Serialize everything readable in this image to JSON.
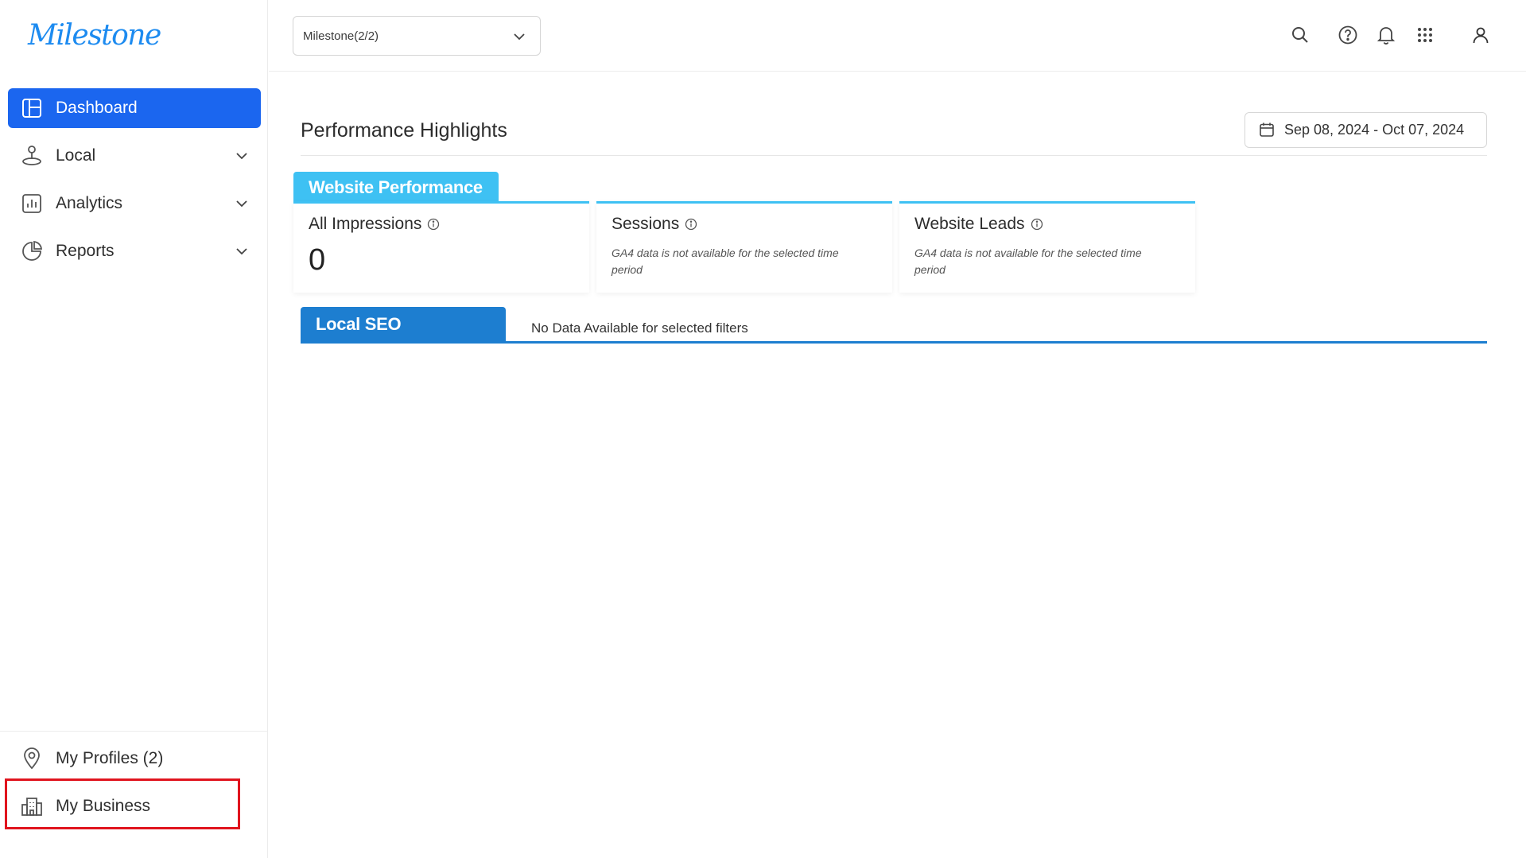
{
  "brand": {
    "logo_text": "Milestone",
    "color": "#1d8bf0"
  },
  "sidebar": {
    "items": [
      {
        "label": "Dashboard",
        "icon": "dashboard-icon",
        "active": true
      },
      {
        "label": "Local",
        "icon": "local-pin-icon",
        "active": false
      },
      {
        "label": "Analytics",
        "icon": "analytics-icon",
        "active": false
      },
      {
        "label": "Reports",
        "icon": "reports-icon",
        "active": false
      }
    ],
    "bottom_items": [
      {
        "label": "My Profiles (2)",
        "icon": "location-pin-icon"
      },
      {
        "label": "My Business",
        "icon": "business-building-icon"
      }
    ],
    "active_color": "#1b66ef"
  },
  "topbar": {
    "account_select": {
      "value": "Milestone(2/2)"
    },
    "icons": [
      "search-icon",
      "help-icon",
      "bell-icon",
      "apps-grid-icon",
      "user-icon"
    ]
  },
  "main": {
    "title": "Performance Highlights",
    "date_range": "Sep 08, 2024 - Oct 07, 2024",
    "website_performance": {
      "tab_label": "Website Performance",
      "tab_color": "#3ec1f3",
      "cards": [
        {
          "title": "All Impressions",
          "value": "0",
          "note": ""
        },
        {
          "title": "Sessions",
          "value": "",
          "note": "GA4 data is not available for the selected time period"
        },
        {
          "title": "Website Leads",
          "value": "",
          "note": "GA4 data is not available for the selected time period"
        }
      ]
    },
    "local_seo": {
      "tab_label": "Local SEO",
      "tab_color": "#1d7ed0",
      "empty_message": "No Data Available for selected filters"
    }
  },
  "highlight_color": "#e0141e"
}
